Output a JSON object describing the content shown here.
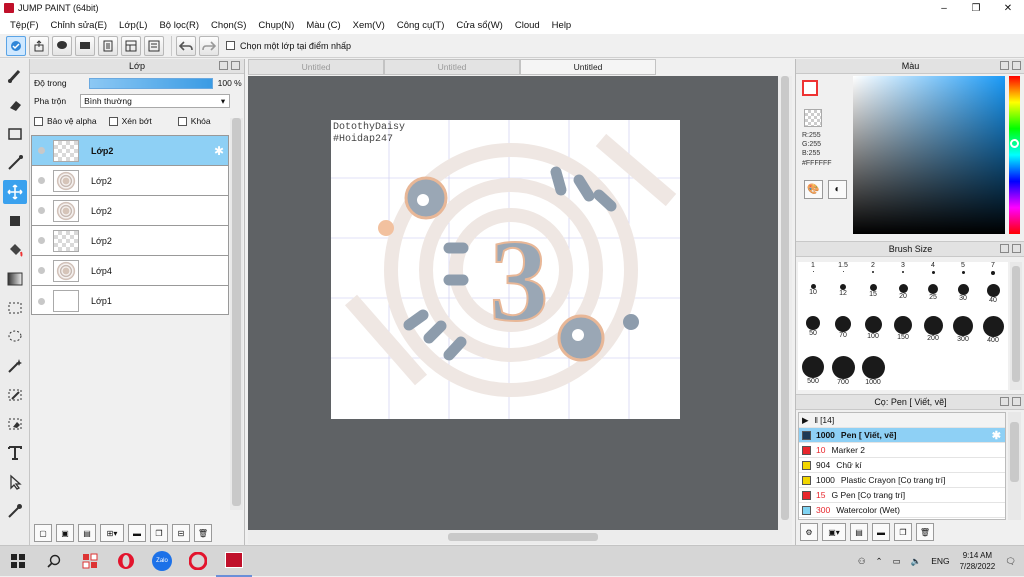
{
  "window": {
    "title": "JUMP PAINT (64bit)",
    "minimize": "–",
    "maximize": "❐",
    "close": "✕"
  },
  "menu": [
    "Tệp(F)",
    "Chỉnh sửa(E)",
    "Lớp(L)",
    "Bộ lọc(R)",
    "Chọn(S)",
    "Chụp(N)",
    "Màu (C)",
    "Xem(V)",
    "Công cụ(T)",
    "Cửa sổ(W)",
    "Cloud",
    "Help"
  ],
  "toolbar": {
    "checkbox_label": "Chọn một lớp tại điểm nhấp"
  },
  "layer_panel": {
    "title": "Lớp",
    "opacity_label": "Độ trong",
    "opacity_value": "100 %",
    "opacity_fraction": 1.0,
    "blend_label": "Pha trộn",
    "blend_value": "Bình thường",
    "protect_alpha": "Bảo vệ alpha",
    "clip": "Xén bớt",
    "lock": "Khóa",
    "layers": [
      {
        "name": "Lớp2",
        "selected": true,
        "thumb": "transparent"
      },
      {
        "name": "Lớp2",
        "selected": false,
        "thumb": "sketch"
      },
      {
        "name": "Lớp2",
        "selected": false,
        "thumb": "sketch"
      },
      {
        "name": "Lớp2",
        "selected": false,
        "thumb": "transparent"
      },
      {
        "name": "Lớp4",
        "selected": false,
        "thumb": "art"
      },
      {
        "name": "Lớp1",
        "selected": false,
        "thumb": "plain"
      }
    ]
  },
  "tabs": [
    {
      "label": "Untitled",
      "active": false
    },
    {
      "label": "Untitled",
      "active": false
    },
    {
      "label": "Untitled",
      "active": true
    }
  ],
  "canvas": {
    "watermark_line1": "DotothyDaisy",
    "watermark_line2": "#Hoidap247",
    "big_number": "3"
  },
  "color_panel": {
    "title": "Màu",
    "r": "R:255",
    "g": "G:255",
    "b": "B:255",
    "hex": "#FFFFFF"
  },
  "brush_panel": {
    "title": "Brush Size",
    "sizes": [
      "1",
      "1.5",
      "2",
      "3",
      "4",
      "5",
      "7",
      "10",
      "12",
      "15",
      "20",
      "25",
      "30",
      "40",
      "50",
      "70",
      "100",
      "150",
      "200",
      "300",
      "400",
      "500",
      "700",
      "1000"
    ]
  },
  "pen_panel": {
    "title": "Cọ: Pen [ Viết, vẽ]",
    "group": "[14]",
    "pens": [
      {
        "count": "1000",
        "name": "Pen [ Viết, vẽ]",
        "color": "#1c3a55",
        "selected": true
      },
      {
        "count": "10",
        "name": "Marker 2",
        "color": "#e8262c",
        "selected": false
      },
      {
        "count": "904",
        "name": "Chữ kí",
        "color": "#f2d600",
        "selected": false
      },
      {
        "count": "1000",
        "name": "Plastic Crayon [Cọ trang trí]",
        "color": "#f2d600",
        "selected": false
      },
      {
        "count": "15",
        "name": "G Pen [Cọ trang trí]",
        "color": "#e8262c",
        "selected": false
      },
      {
        "count": "300",
        "name": "Watercolor (Wet)",
        "color": "#7fd3f2",
        "selected": false
      }
    ]
  },
  "taskbar": {
    "apps": [
      "Zalo"
    ],
    "lang": "ENG",
    "time": "9:14 AM",
    "date": "7/28/2022"
  }
}
